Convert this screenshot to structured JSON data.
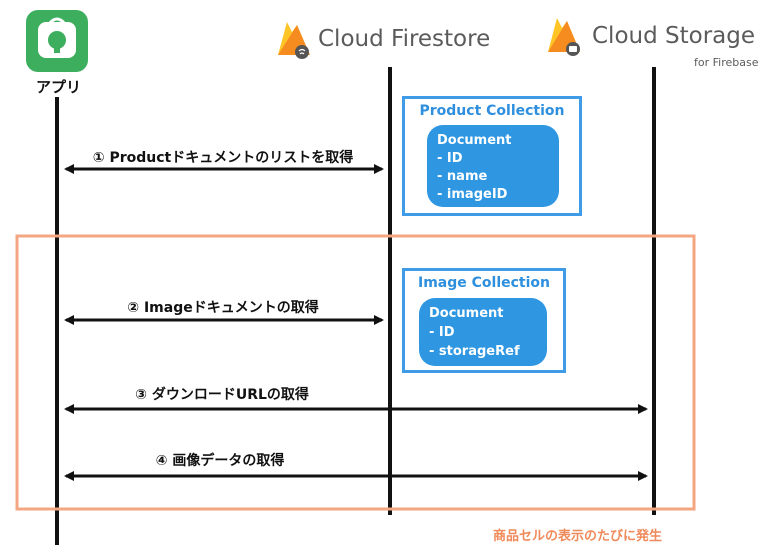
{
  "app": {
    "label": "アプリ"
  },
  "services": {
    "firestore": {
      "name": "Cloud Firestore"
    },
    "storage": {
      "name": "Cloud Storage",
      "subtitle": "for Firebase"
    }
  },
  "collections": {
    "product": {
      "title": "Product Collection",
      "fields": [
        "Document",
        "- ID",
        "- name",
        "- imageID"
      ]
    },
    "image": {
      "title": "Image Collection",
      "fields": [
        "Document",
        "- ID",
        "- storageRef"
      ]
    }
  },
  "messages": [
    {
      "label": "① Productドキュメントのリストを取得"
    },
    {
      "label": "② Imageドキュメントの取得"
    },
    {
      "label": "③ ダウンロードURLの取得"
    },
    {
      "label": "④ 画像データの取得"
    }
  ],
  "frame": {
    "note": "商品セルの表示のたびに発生"
  },
  "colors": {
    "orange": "#f4a582",
    "orange_text": "#ef8a5a",
    "blue": "#3f9be6",
    "app_green": "#3dae5e",
    "firebase_yellow": "#ffc425",
    "firebase_orange": "#f58220"
  }
}
